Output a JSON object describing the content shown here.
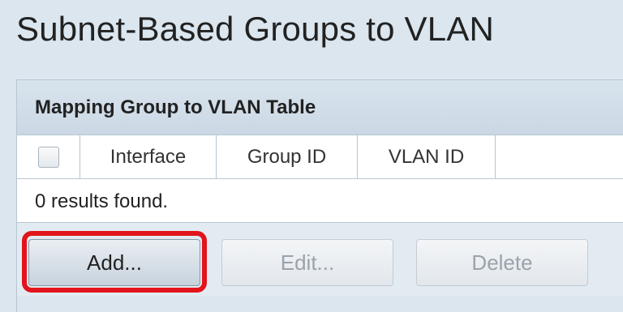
{
  "page": {
    "title": "Subnet-Based Groups to VLAN"
  },
  "table": {
    "title": "Mapping Group to VLAN Table",
    "columns": [
      "Interface",
      "Group ID",
      "VLAN ID"
    ],
    "rows": [],
    "results_text": "0 results found."
  },
  "buttons": {
    "add_label": "Add...",
    "edit_label": "Edit...",
    "delete_label": "Delete"
  },
  "colors": {
    "highlight": "#e2141c"
  }
}
